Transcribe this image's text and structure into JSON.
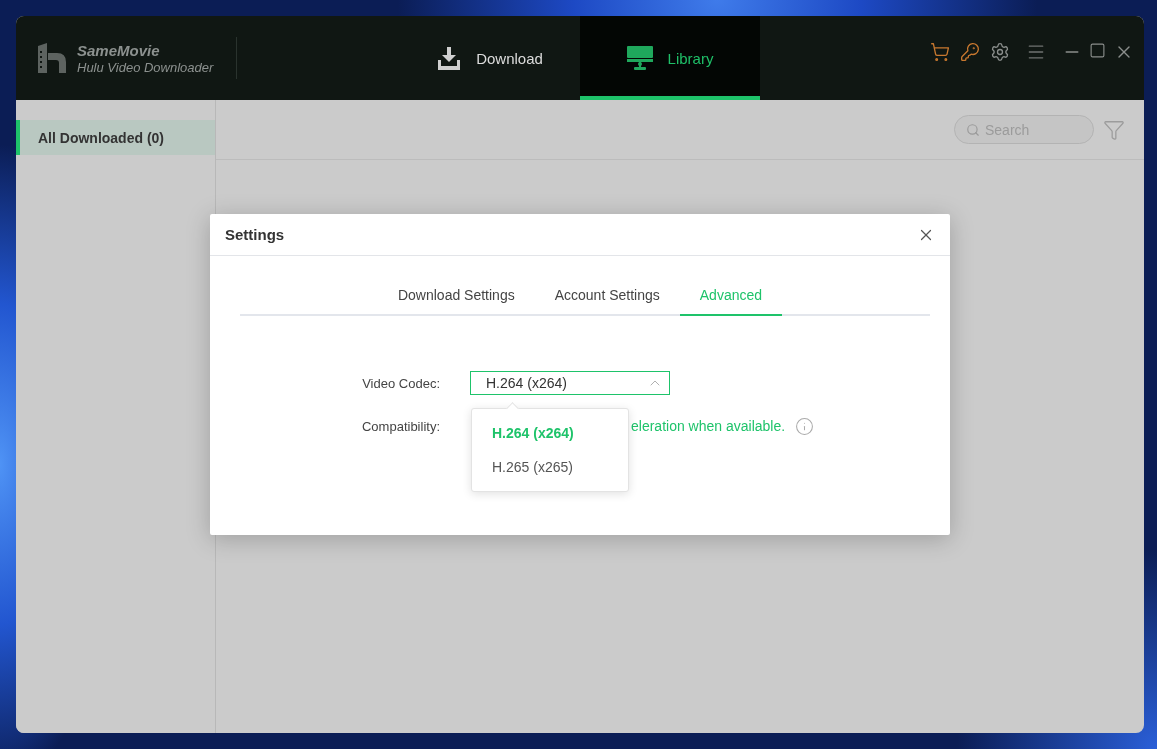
{
  "app_header": {
    "brand": "SameMovie",
    "product": "Hulu Video Downloader",
    "nav_tabs": [
      {
        "label": "Download",
        "selected": false
      },
      {
        "label": "Library",
        "selected": true
      }
    ]
  },
  "sidebar": {
    "items": [
      {
        "label": "All Downloaded (0)",
        "selected": true
      }
    ]
  },
  "toolbar": {
    "search": {
      "placeholder": "Search"
    }
  },
  "settings_dialog": {
    "title": "Settings",
    "tabs": [
      {
        "label": "Download Settings",
        "selected": false
      },
      {
        "label": "Account Settings",
        "selected": false
      },
      {
        "label": "Advanced",
        "selected": true
      }
    ],
    "fields": [
      {
        "kind": "select",
        "label": "Video Codec:",
        "value": "H.264 (x264)",
        "expanded": true,
        "options": [
          {
            "label": "H.264 (x264)",
            "selected": true
          },
          {
            "label": "H.265 (x265)",
            "selected": false
          }
        ]
      },
      {
        "kind": "note",
        "label": "Compatibility:",
        "text": "eleration when available."
      }
    ]
  }
}
